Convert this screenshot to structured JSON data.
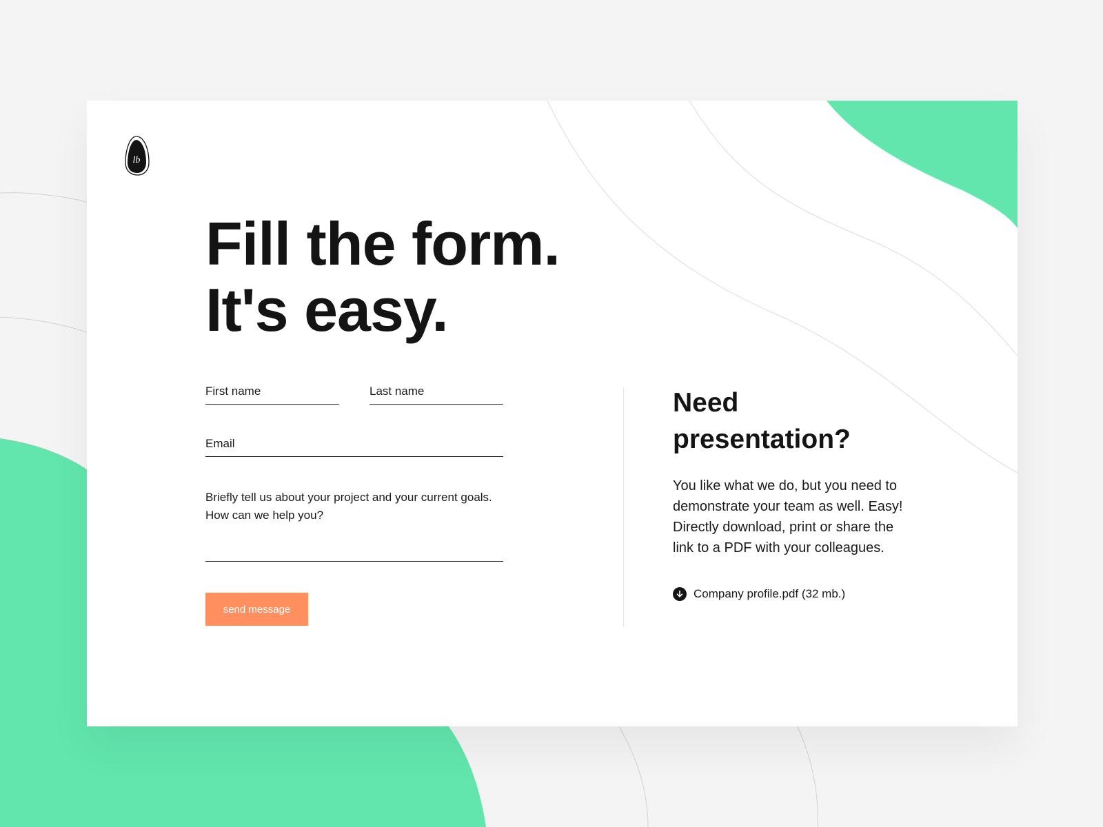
{
  "brand": {
    "logo_text": "lb"
  },
  "headline": {
    "line1": "Fill the form.",
    "line2": "It's easy."
  },
  "form": {
    "first_name": {
      "label": "First name",
      "value": ""
    },
    "last_name": {
      "label": "Last name",
      "value": ""
    },
    "email": {
      "label": "Email",
      "value": ""
    },
    "message": {
      "label_line1": "Briefly tell us about your project and your current goals.",
      "label_line2": "How can we help you?",
      "value": ""
    },
    "submit_label": "send message"
  },
  "sidebar": {
    "title_line1": "Need",
    "title_line2": "presentation?",
    "description": [
      "You like what we do, but you need to",
      "demonstrate your team as well. Easy!",
      "Directly download, print or share the",
      "link to a PDF with your colleagues."
    ],
    "download": {
      "icon": "download-icon",
      "label": "Company profile.pdf (32 mb.)"
    }
  },
  "colors": {
    "accent_green": "#62e6ae",
    "button_orange": "#ff8f5e",
    "text": "#141414",
    "background": "#f4f4f4",
    "card": "#ffffff"
  }
}
